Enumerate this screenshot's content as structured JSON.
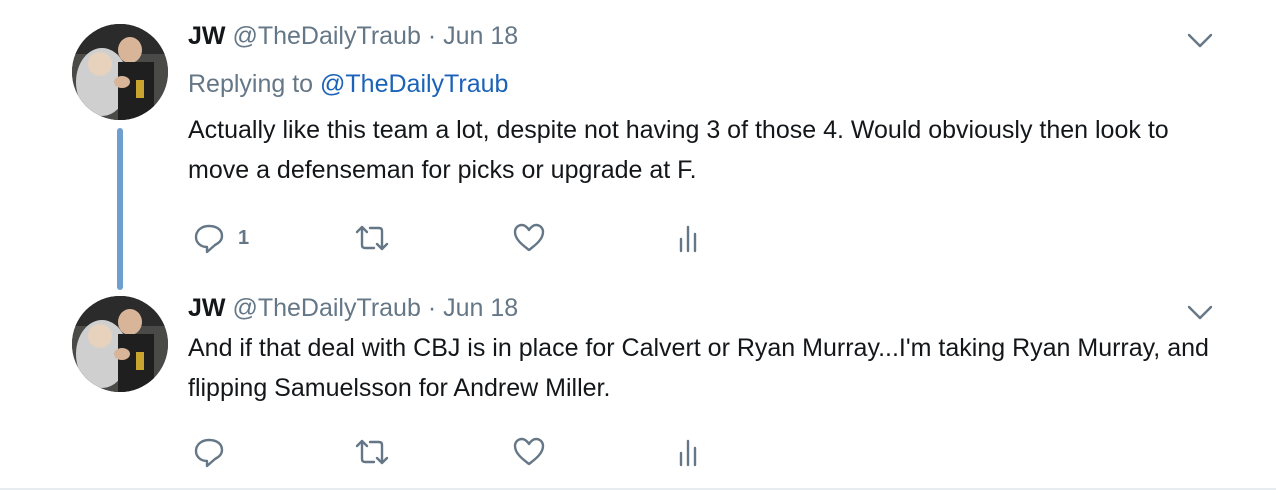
{
  "tweets": [
    {
      "name": "JW",
      "handle": "@TheDailyTraub",
      "separator": "·",
      "date": "Jun 18",
      "replying_prefix": "Replying to",
      "replying_to": "@TheDailyTraub",
      "text": "Actually like this team a lot, despite not having 3 of those 4. Would obviously then look to move a defenseman for picks or upgrade at F.",
      "reply_count": "1",
      "icons": [
        "reply-icon",
        "retweet-icon",
        "like-icon",
        "analytics-icon",
        "chevron-down-icon"
      ]
    },
    {
      "name": "JW",
      "handle": "@TheDailyTraub",
      "separator": "·",
      "date": "Jun 18",
      "text": "And if that deal with CBJ is in place for Calvert or Ryan Murray...I'm taking Ryan Murray, and flipping Samuelsson for Andrew Miller.",
      "icons": [
        "reply-icon",
        "retweet-icon",
        "like-icon",
        "analytics-icon",
        "chevron-down-icon"
      ]
    }
  ],
  "colors": {
    "text": "#14171a",
    "secondary": "#657786",
    "link": "#1b63b8",
    "thread_line": "#6e9fcf",
    "divider": "#e6ecf0"
  }
}
